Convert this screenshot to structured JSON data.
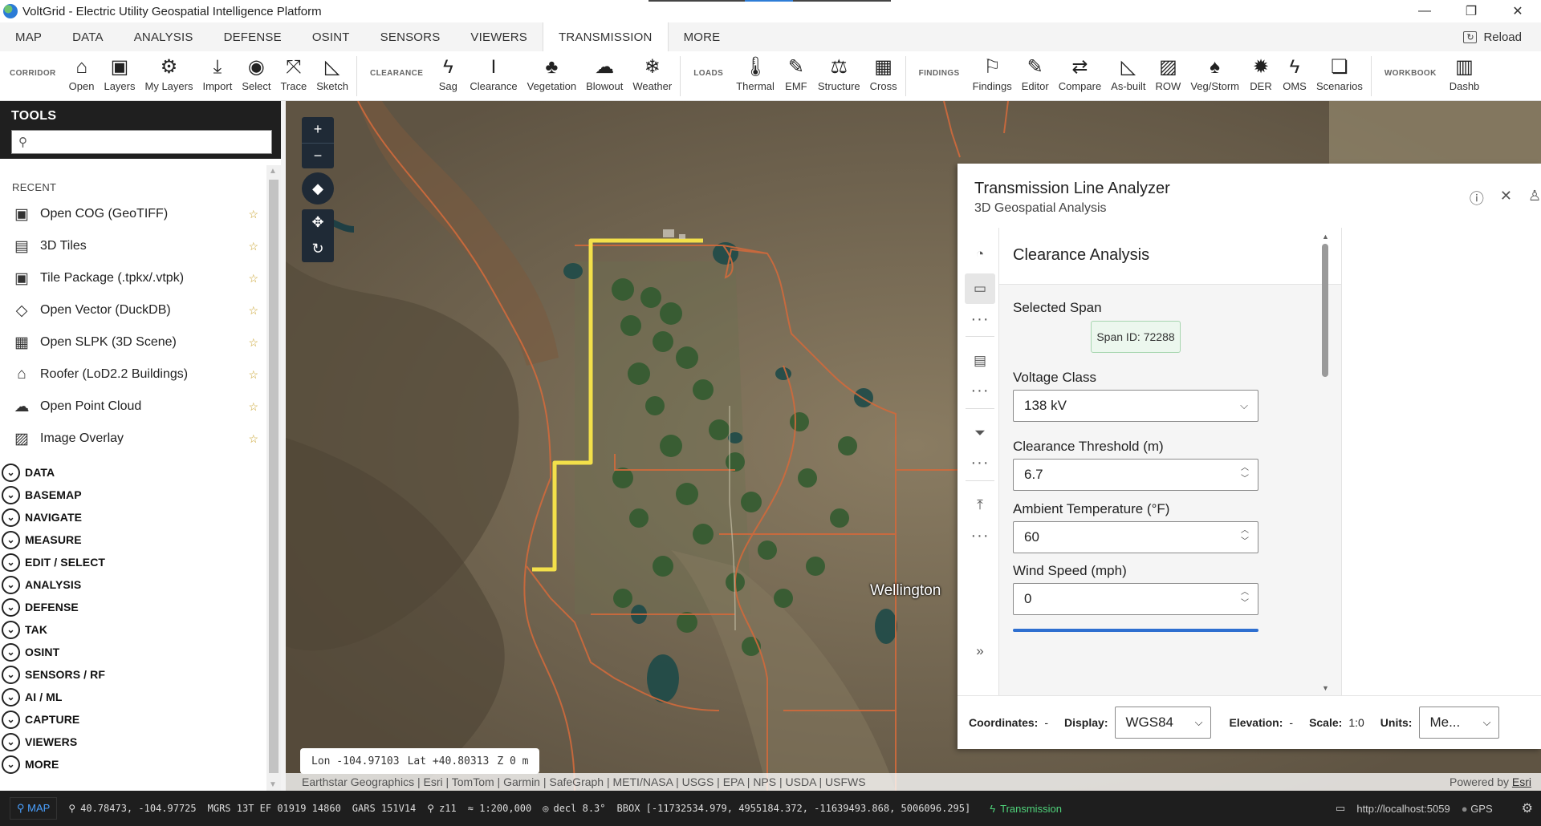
{
  "window": {
    "title": "VoltGrid - Electric Utility Geospatial Intelligence Platform",
    "minimize": "—",
    "restore": "❐",
    "close": "✕"
  },
  "menu": {
    "tabs": [
      "MAP",
      "DATA",
      "ANALYSIS",
      "DEFENSE",
      "OSINT",
      "SENSORS",
      "VIEWERS",
      "TRANSMISSION",
      "MORE"
    ],
    "active": "TRANSMISSION",
    "reload_label": "Reload"
  },
  "ribbon": {
    "groups": [
      {
        "label": "CORRIDOR",
        "tools": [
          {
            "label": "Open",
            "icon": "home-icon",
            "glyph": "⌂"
          },
          {
            "label": "Layers",
            "icon": "layers-icon",
            "glyph": "▣"
          },
          {
            "label": "My Layers",
            "icon": "my-layers-icon",
            "glyph": "⚙"
          },
          {
            "label": "Import",
            "icon": "import-icon",
            "glyph": "⤓"
          },
          {
            "label": "Select",
            "icon": "select-icon",
            "glyph": "◉"
          },
          {
            "label": "Trace",
            "icon": "trace-icon",
            "glyph": "⤧"
          },
          {
            "label": "Sketch",
            "icon": "sketch-icon",
            "glyph": "◺"
          }
        ]
      },
      {
        "label": "CLEARANCE",
        "tools": [
          {
            "label": "Sag",
            "icon": "lightning-icon",
            "glyph": "ϟ"
          },
          {
            "label": "Clearance",
            "icon": "clearance-icon",
            "glyph": "I"
          },
          {
            "label": "Vegetation",
            "icon": "tree-icon",
            "glyph": "♣"
          },
          {
            "label": "Blowout",
            "icon": "blowout-icon",
            "glyph": "☁"
          },
          {
            "label": "Weather",
            "icon": "weather-icon",
            "glyph": "❄"
          }
        ]
      },
      {
        "label": "LOADS",
        "tools": [
          {
            "label": "Thermal",
            "icon": "thermometer-icon",
            "glyph": "🌡"
          },
          {
            "label": "EMF",
            "icon": "emf-icon",
            "glyph": "✎"
          },
          {
            "label": "Structure",
            "icon": "structure-icon",
            "glyph": "⚖"
          },
          {
            "label": "Cross",
            "icon": "cross-section-icon",
            "glyph": "▦"
          }
        ]
      },
      {
        "label": "FINDINGS",
        "tools": [
          {
            "label": "Findings",
            "icon": "flag-icon",
            "glyph": "⚐"
          },
          {
            "label": "Editor",
            "icon": "editor-icon",
            "glyph": "✎"
          },
          {
            "label": "Compare",
            "icon": "compare-icon",
            "glyph": "⇄"
          },
          {
            "label": "As-built",
            "icon": "as-built-icon",
            "glyph": "◺"
          },
          {
            "label": "ROW",
            "icon": "row-icon",
            "glyph": "▨"
          },
          {
            "label": "Veg/Storm",
            "icon": "veg-storm-icon",
            "glyph": "♠"
          },
          {
            "label": "DER",
            "icon": "der-icon",
            "glyph": "✹"
          },
          {
            "label": "OMS",
            "icon": "oms-icon",
            "glyph": "ϟ"
          },
          {
            "label": "Scenarios",
            "icon": "scenarios-icon",
            "glyph": "❏"
          }
        ]
      },
      {
        "label": "WORKBOOK",
        "tools": [
          {
            "label": "Dashb",
            "icon": "dashboard-icon",
            "glyph": "▥"
          }
        ]
      }
    ]
  },
  "tools_panel": {
    "title": "TOOLS",
    "search_value": "",
    "recent_header": "RECENT",
    "recent": [
      {
        "label": "Open COG (GeoTIFF)",
        "icon": "cog-icon",
        "glyph": "▣"
      },
      {
        "label": "3D Tiles",
        "icon": "tiles-3d-icon",
        "glyph": "▤"
      },
      {
        "label": "Tile Package (.tpkx/.vtpk)",
        "icon": "tile-package-icon",
        "glyph": "▣"
      },
      {
        "label": "Open Vector (DuckDB)",
        "icon": "duckdb-icon",
        "glyph": "◇"
      },
      {
        "label": "Open SLPK (3D Scene)",
        "icon": "slpk-icon",
        "glyph": "▦"
      },
      {
        "label": "Roofer (LoD2.2 Buildings)",
        "icon": "building-icon",
        "glyph": "⌂"
      },
      {
        "label": "Open Point Cloud",
        "icon": "cloud-icon",
        "glyph": "☁"
      },
      {
        "label": "Image Overlay",
        "icon": "image-overlay-icon",
        "glyph": "▨"
      }
    ],
    "star": "☆",
    "categories": [
      "DATA",
      "BASEMAP",
      "NAVIGATE",
      "MEASURE",
      "EDIT / SELECT",
      "ANALYSIS",
      "DEFENSE",
      "TAK",
      "OSINT",
      "SENSORS / RF",
      "AI / ML",
      "CAPTURE",
      "VIEWERS",
      "MORE"
    ]
  },
  "map": {
    "zoom_in": "+",
    "zoom_out": "−",
    "place_label": "Wellington",
    "cursor": {
      "lon": "Lon -104.97103",
      "lat": "Lat +40.80313",
      "z": "Z 0 m"
    },
    "attribution": "Earthstar Geographics | Esri | TomTom | Garmin | SafeGraph | METI/NASA | USGS | EPA | NPS | USDA | USFWS",
    "powered_prefix": "Powered by ",
    "powered_link": "Esri",
    "line_color": "#f3e04a",
    "road_color": "#d06a3c"
  },
  "analyzer": {
    "title": "Transmission Line Analyzer",
    "subtitle": "3D Geospatial Analysis",
    "section_title": "Clearance Analysis",
    "selected_span_label": "Selected Span",
    "span_id": "Span ID: 72288",
    "voltage_label": "Voltage Class",
    "voltage_value": "138 kV",
    "clearance_label": "Clearance Threshold (m)",
    "clearance_value": "6.7",
    "temp_label": "Ambient Temperature (°F)",
    "temp_value": "60",
    "wind_label": "Wind Speed (mph)",
    "wind_value": "0",
    "bottom": {
      "coordinates_label": "Coordinates:",
      "coordinates_value": "-",
      "display_label": "Display:",
      "display_value": "WGS84",
      "elevation_label": "Elevation:",
      "elevation_value": "-",
      "scale_label": "Scale:",
      "scale_value": "1:0",
      "units_label": "Units:",
      "units_value": "Me..."
    }
  },
  "status": {
    "map_label": "MAP",
    "latlon": "40.78473, -104.97725",
    "mgrs": "MGRS 13T EF 01919 14860",
    "gars": "GARS 151V14",
    "zoom": "z11",
    "scale": "≈ 1:200,000",
    "decl": "decl 8.3°",
    "bbox": "BBOX [-11732534.979, 4955184.372, -11639493.868, 5006096.295]",
    "mode": "Transmission",
    "url": "http://localhost:5059",
    "gps": "GPS"
  }
}
